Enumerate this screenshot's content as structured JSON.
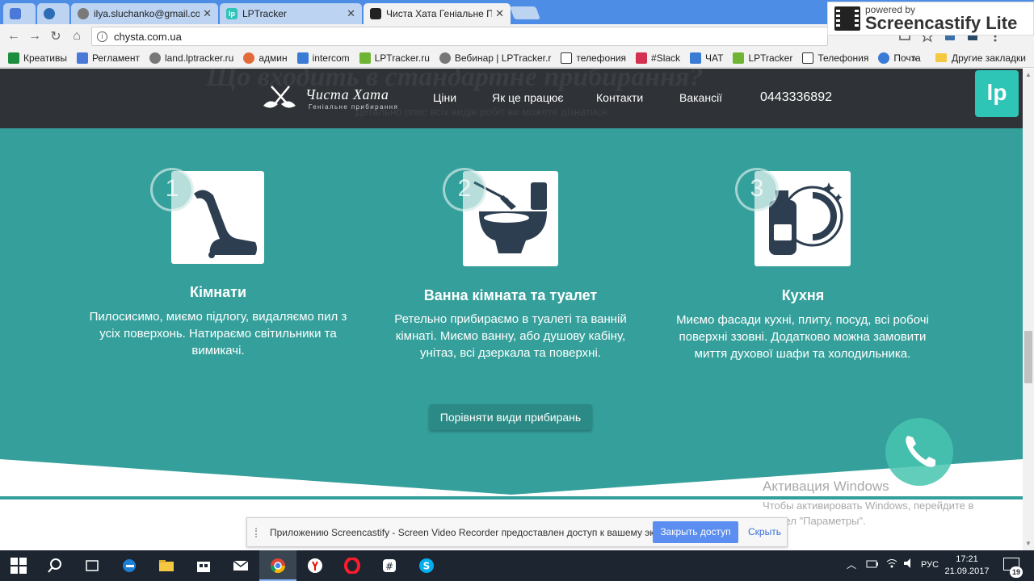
{
  "tabs": [
    {
      "title": "",
      "favicon": "doc-icon",
      "color": "#4a79d8"
    },
    {
      "title": "",
      "favicon": "globe-icon",
      "color": "#2e6db5"
    },
    {
      "title": "ilya.sluchanko@gmail.co",
      "favicon": "mail-icon",
      "color": "#7a7a7a"
    },
    {
      "title": "LPTracker",
      "favicon": "lp-icon",
      "color": "#2ec4b6"
    },
    {
      "title": "Чиста Хата Геніальне Пр",
      "favicon": "broom-icon",
      "color": "#222222"
    }
  ],
  "screencastify": {
    "powered": "powered by",
    "name": "Screencastify Lite"
  },
  "address": {
    "url": "chysta.com.ua"
  },
  "bookmarks": [
    {
      "label": "Креативы",
      "color": "#1e8e3e"
    },
    {
      "label": "Регламент",
      "color": "#4a79d8"
    },
    {
      "label": "land.lptracker.ru",
      "color": "#777777"
    },
    {
      "label": "админ",
      "color": "#e26b3b"
    },
    {
      "label": "intercom",
      "color": "#3a7bd5"
    },
    {
      "label": "LPTracker.ru",
      "color": "#6fb432"
    },
    {
      "label": "Вебинар | LPTracker.r",
      "color": "#777777"
    },
    {
      "label": "телефония",
      "color": "#333333"
    },
    {
      "label": "#Slack",
      "color": "#d3314f"
    },
    {
      "label": "ЧАТ",
      "color": "#3a7bd5"
    },
    {
      "label": "LPTracker",
      "color": "#6fb432"
    },
    {
      "label": "Телефония",
      "color": "#333333"
    },
    {
      "label": "Почта",
      "color": "#3a7bd5"
    }
  ],
  "bookmarks_more": "»",
  "bookmarks_other": "Другие закладки",
  "site": {
    "ghost_heading": "Що входить в стандартне прибирання?",
    "ghost_sub": "Детально опис всіх видів робіт ви можете дізнатися",
    "logo_name": "Чиста Хата",
    "logo_tagline": "Геніальне прибирання",
    "nav": [
      "Ціни",
      "Як це працює",
      "Контакти",
      "Вакансії"
    ],
    "phone": "0443336892",
    "lp_badge": "lp",
    "cards": [
      {
        "num": "1",
        "title": "Кімнати",
        "desc": "Пилосисимо, миємо підлогу, видаляємо пил з усіх поверхонь. Натираємо світильники та вимикачі.",
        "icon": "vacuum-icon"
      },
      {
        "num": "2",
        "title": "Ванна кімната та туалет",
        "desc": "Ретельно прибираємо в туалеті та ванній кімнаті. Миємо ванну, або душову кабіну, унітаз, всі дзеркала та поверхні.",
        "icon": "toilet-icon"
      },
      {
        "num": "3",
        "title": "Кухня",
        "desc": "Миємо фасади кухні, плиту, посуд, всі робочі поверхні ззовні. Додатково можна замовити миття духової шафи та холодильника.",
        "icon": "dishwashing-icon"
      }
    ],
    "compare_button": "Порівняти види прибирань"
  },
  "windows_activation": {
    "title": "Активация Windows",
    "text": "Чтобы активировать Windows, перейдите в раздел \"Параметры\"."
  },
  "share_bar": {
    "message": "Приложению Screencastify - Screen Video Recorder предоставлен доступ к вашему экрану.",
    "stop": "Закрыть доступ",
    "hide": "Скрыть"
  },
  "taskbar": {
    "lang": "РУС",
    "time": "17:21",
    "date": "21.09.2017",
    "notifications": "19"
  },
  "colors": {
    "teal": "#35a09b",
    "header": "#2f3236",
    "icon_dark": "#2c3e50"
  }
}
